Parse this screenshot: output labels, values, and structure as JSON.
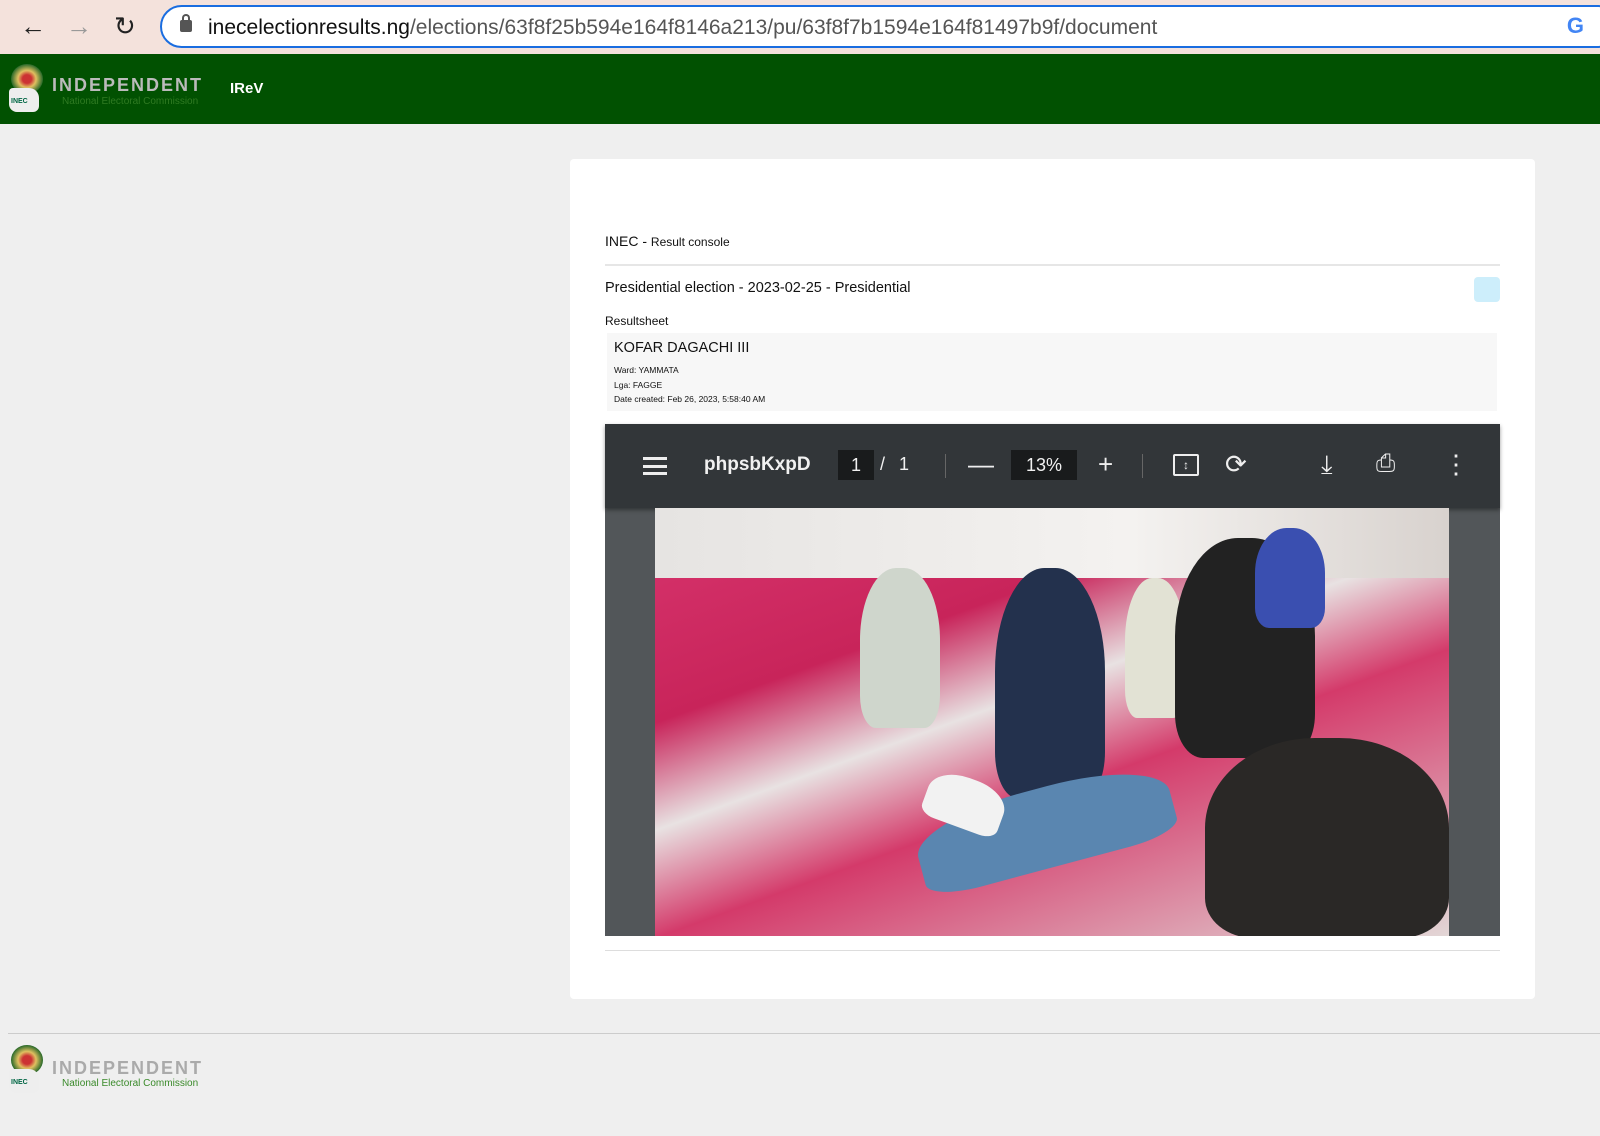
{
  "browser": {
    "url_host": "inecelectionresults.ng",
    "url_path": "/elections/63f8f25b594e164f8146a213/pu/63f8f7b1594e164f81497b9f/document"
  },
  "header": {
    "brand": "INDEPENDENT",
    "brand_sub": "National Electoral Commission",
    "logo_text": "INEC",
    "nav": "IReV"
  },
  "console": {
    "title": "INEC",
    "title_suffix": "Result console",
    "election": "Presidential election - 2023-02-25 - Presidential",
    "section": "Resultsheet"
  },
  "unit": {
    "name": "KOFAR DAGACHI III",
    "ward": "Ward: YAMMATA",
    "lga": "Lga: FAGGE",
    "date": "Date created: Feb 26, 2023, 5:58:40 AM"
  },
  "pdf": {
    "filename": "phpsbKxpD",
    "page": "1",
    "sep": "/",
    "total": "1",
    "zoom": "13%"
  },
  "footer": {
    "brand": "INDEPENDENT",
    "brand_sub": "National Electoral Commission",
    "logo_text": "INEC"
  }
}
